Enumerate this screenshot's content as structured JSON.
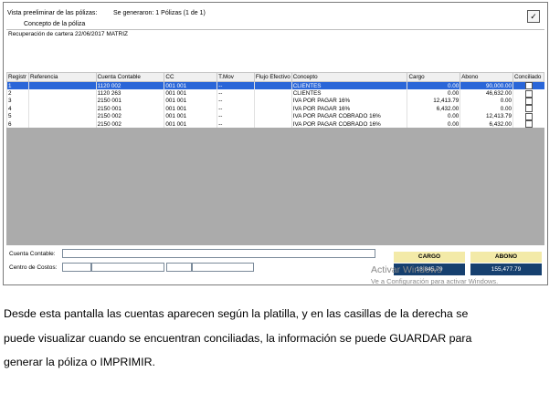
{
  "header": {
    "vista_label": "Vista preeliminar de las pólizas:",
    "generated_text": "Se generaron: 1 Pólizas (1 de 1)",
    "concepto_label": "Concepto de la póliza",
    "check_glyph": "✓"
  },
  "concepto_text": "Recuperación de cartera 22/06/2017 MATRIZ",
  "table": {
    "columns": [
      "Registr",
      "Referencia",
      "Cuenta Contable",
      "CC",
      "T.Mov",
      "Flujo Efectivo",
      "Concepto",
      "Cargo",
      "Abono",
      "Conciliado"
    ],
    "rows": [
      {
        "reg": "1",
        "ref": "",
        "cuenta": "1120 002",
        "cc": "001 001",
        "tmov": "--",
        "flujo": "",
        "concepto": "CLIENTES",
        "cargo": "0.00",
        "abono": "90,000.00",
        "conciliado": false,
        "selected": true
      },
      {
        "reg": "2",
        "ref": "",
        "cuenta": "1120 263",
        "cc": "001 001",
        "tmov": "--",
        "flujo": "",
        "concepto": "CLIENTES",
        "cargo": "0.00",
        "abono": "46,632.00",
        "conciliado": false,
        "selected": false
      },
      {
        "reg": "3",
        "ref": "",
        "cuenta": "2150 001",
        "cc": "001 001",
        "tmov": "--",
        "flujo": "",
        "concepto": "IVA POR PAGAR 16%",
        "cargo": "12,413.79",
        "abono": "0.00",
        "conciliado": false,
        "selected": false
      },
      {
        "reg": "4",
        "ref": "",
        "cuenta": "2150 001",
        "cc": "001 001",
        "tmov": "--",
        "flujo": "",
        "concepto": "IVA POR PAGAR 16%",
        "cargo": "6,432.00",
        "abono": "0.00",
        "conciliado": false,
        "selected": false
      },
      {
        "reg": "5",
        "ref": "",
        "cuenta": "2150 002",
        "cc": "001 001",
        "tmov": "--",
        "flujo": "",
        "concepto": "IVA POR PAGAR COBRADO 16%",
        "cargo": "0.00",
        "abono": "12,413.79",
        "conciliado": false,
        "selected": false
      },
      {
        "reg": "6",
        "ref": "",
        "cuenta": "2150 002",
        "cc": "001 001",
        "tmov": "--",
        "flujo": "",
        "concepto": "IVA POR PAGAR COBRADO 16%",
        "cargo": "0.00",
        "abono": "6,432.00",
        "conciliado": false,
        "selected": false
      }
    ]
  },
  "bottom": {
    "cuenta_label": "Cuenta Contable:",
    "centro_label": "Centro de Costos:"
  },
  "totals": {
    "cargo_label": "CARGO",
    "cargo_value": "18,845.79",
    "abono_label": "ABONO",
    "abono_value": "155,477.79"
  },
  "watermark": {
    "line1": "Activar Windows",
    "line2": "Ve a Configuración para activar Windows."
  },
  "paragraph": [
    "Desde esta pantalla las cuentas aparecen según la platilla, y en las casillas de la derecha se",
    "puede visualizar cuando se encuentran conciliadas, la información se puede GUARDAR para",
    "generar la póliza o IMPRIMIR."
  ],
  "colors": {
    "selection": "#2a66d8",
    "totals_header": "#f3eaa8",
    "totals_value": "#16406f",
    "grid_empty": "#ababab"
  }
}
